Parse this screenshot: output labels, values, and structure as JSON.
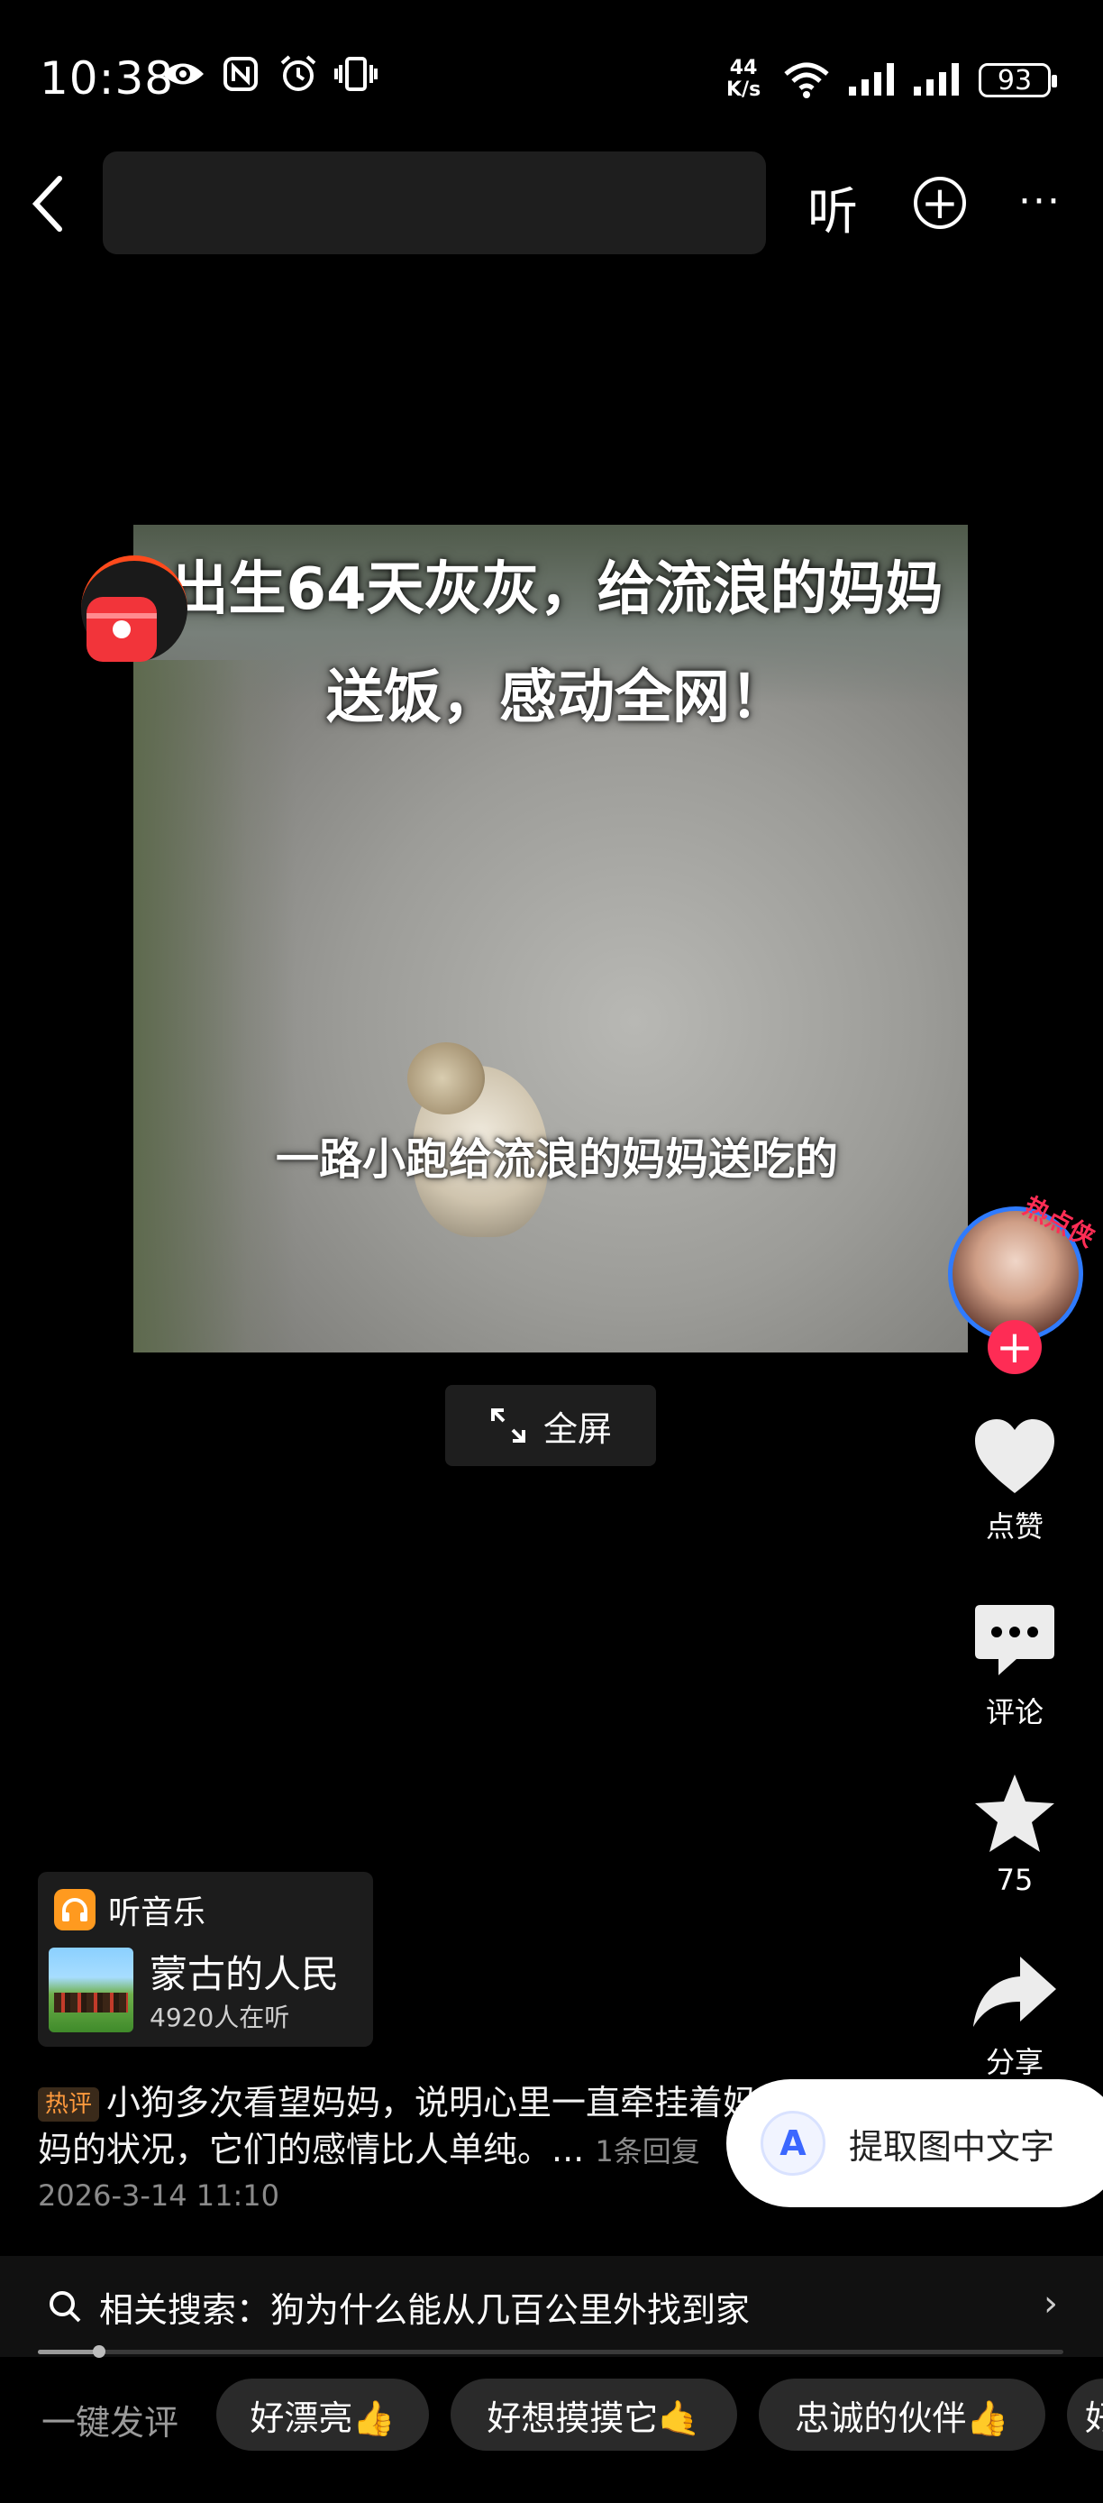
{
  "status_bar": {
    "time": "10:38",
    "net_speed_value": "44",
    "net_speed_unit": "K/s",
    "battery": "93"
  },
  "top_bar": {
    "listen_label": "听"
  },
  "video": {
    "title_text": "出生64天灰灰，给流浪的妈妈送饭，感动全网！",
    "subtitle_text": "一路小跑给流浪的妈妈送吃的",
    "fullscreen_label": "全屏"
  },
  "author": {
    "hot_badge": "热点侠"
  },
  "sidebar": {
    "like_label": "点赞",
    "comment_label": "评论",
    "favorite_count": "75",
    "share_label": "分享"
  },
  "music": {
    "header": "听音乐",
    "title": "蒙古的人民",
    "listeners": "4920人在听"
  },
  "hot_comment": {
    "tag": "热评",
    "text": "小狗多次看望妈妈，说明心里一直牵挂着妈妈的状况，它们的感情比人单纯。...",
    "replies": "1条回复",
    "time": "2026-3-14 11:10"
  },
  "ocr_popup": {
    "label": "提取图中文字"
  },
  "related_search": {
    "text": "相关搜索：狗为什么能从几百公里外找到家",
    "progress": 0.06
  },
  "quick_comments": {
    "label": "一键发评",
    "chips": [
      "好漂亮👍",
      "好想摸摸它🤙",
      "忠诚的伙伴👍",
      "好"
    ]
  },
  "colors": {
    "accent_red": "#fe2c55",
    "ocr_blue": "#3b67ff",
    "hot_tag_orange": "#ff9a3d",
    "headphone_orange": "#ff9a1f"
  },
  "icons": [
    "eye-icon",
    "nfc-icon",
    "alarm-icon",
    "vibrate-icon",
    "wifi-icon",
    "signal-icon",
    "back-icon",
    "plus-icon",
    "more-icon",
    "red-packet-icon",
    "expand-icon",
    "heart-icon",
    "comment-icon",
    "star-icon",
    "share-icon",
    "headphone-icon",
    "ocr-icon",
    "search-icon",
    "chevron-right-icon"
  ]
}
